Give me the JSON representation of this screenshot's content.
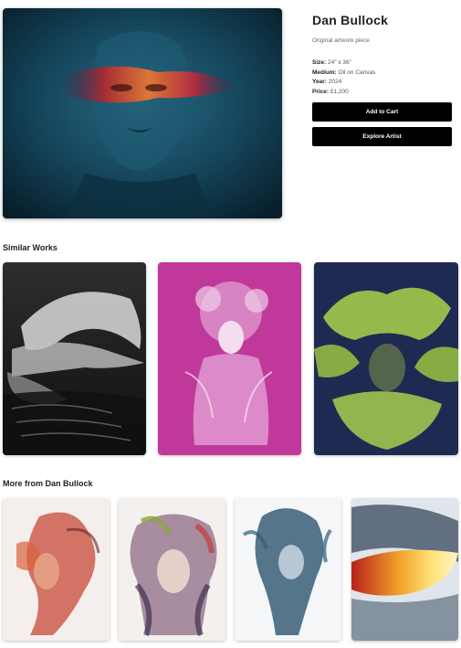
{
  "artist": {
    "name": "Dan Bullock",
    "subtitle": "Original artwork piece"
  },
  "specs": {
    "size_label": "Size:",
    "size_value": "24\" x 36\"",
    "medium_label": "Medium:",
    "medium_value": "Oil on Canvas",
    "year_label": "Year:",
    "year_value": "2024",
    "price_label": "Price:",
    "price_value": "£1,200"
  },
  "buttons": {
    "add_to_cart": "Add to Cart",
    "explore_artist": "Explore Artist"
  },
  "sections": {
    "similar_works": "Similar Works",
    "more_from": "More from Dan Bullock"
  },
  "colors": {
    "button_bg": "#000000",
    "button_text": "#ffffff",
    "hero_bg": "#123a4e",
    "similar_1_bg": "#1b1b1b",
    "similar_2_bg": "#c0399a",
    "similar_3_bg": "#1f2a52"
  }
}
